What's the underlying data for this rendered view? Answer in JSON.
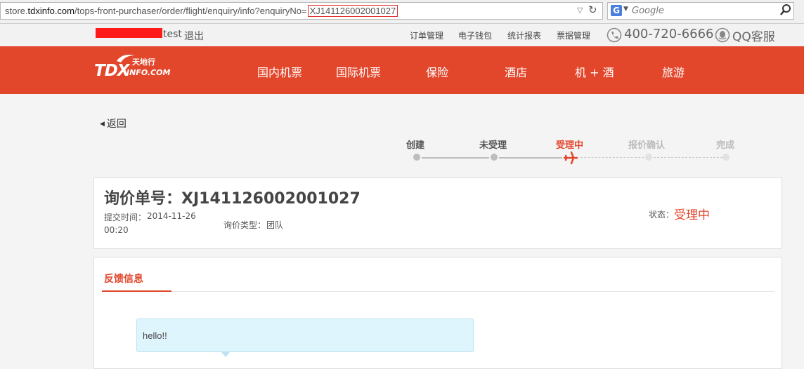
{
  "browser": {
    "url_prefix": "store.",
    "url_domain": "tdxinfo.com",
    "url_path": "/tops-front-purchaser/order/flight/enquiry/info?enquiryNo=",
    "url_param": "XJ141126002001027",
    "reload_icon": "reload-icon",
    "search_engine": "G",
    "search_placeholder": "Google"
  },
  "topbar": {
    "user": "test",
    "logout": "退出",
    "links": [
      "订单管理",
      "电子钱包",
      "统计报表",
      "票据管理"
    ],
    "phone": "400-720-6666",
    "qq": "QQ客服"
  },
  "nav": {
    "logo_main": "TDX",
    "logo_sub": "INFO.COM",
    "logo_cn": "天地行",
    "items": [
      "国内机票",
      "国际机票",
      "保险",
      "酒店",
      "机 + 酒",
      "旅游"
    ]
  },
  "back": {
    "label": "返回"
  },
  "progress": {
    "steps": [
      "创建",
      "未受理",
      "受理中",
      "报价确认",
      "完成"
    ],
    "current_index": 2
  },
  "enquiry": {
    "title": "询价单号：XJ141126002001027",
    "submit_label": "提交时间：",
    "submit_date": "2014-11-26",
    "submit_time": "00:20",
    "type_label": "询价类型：",
    "type_value": "团队",
    "status_label": "状态：",
    "status_value": "受理中"
  },
  "feedback": {
    "tab": "反馈信息",
    "message": "hello!!"
  },
  "colors": {
    "brand_red": "#e2462b",
    "bubble_bg": "#dff5fd"
  }
}
